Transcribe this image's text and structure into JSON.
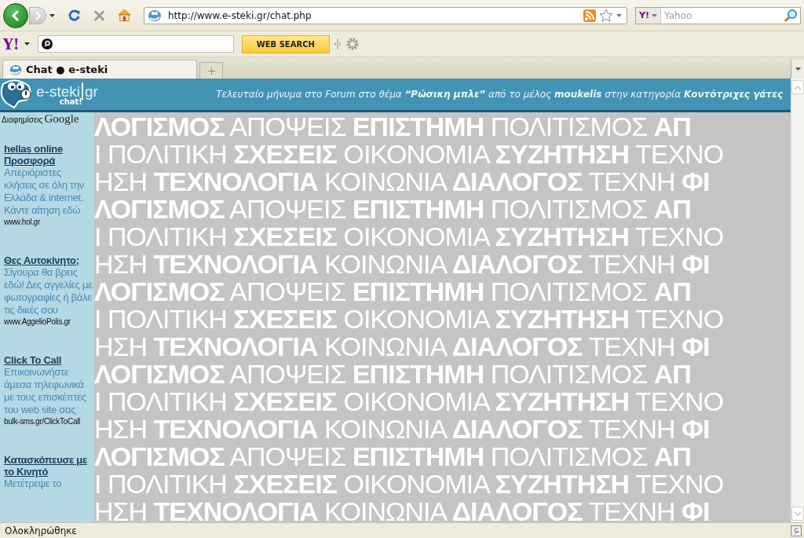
{
  "browser": {
    "address": "http://www.e-steki.gr/chat.php",
    "search_engine_logo": "Y!",
    "search": {
      "placeholder": "Yahoo"
    },
    "toolbar": {
      "logo": "Y!",
      "button": "WEB SEARCH"
    },
    "tabs": [
      {
        "label": "Chat ● e-steki",
        "selected": true
      }
    ]
  },
  "header": {
    "logo": {
      "name": "e-steki",
      "tld": "gr",
      "sub": "chat!"
    },
    "message": "Τελευταίο μήνυμα στο Forum στο θέμα **“Ρώσικη μπλε”** από το μέλος **moukelis** στην κατηγορία **Κοντότριχες γάτες**"
  },
  "sidebar": {
    "label": "Διαφημίσεις",
    "brand": "Google",
    "ads": [
      {
        "title": "hellas online Προσφορά",
        "body": "Απεριόριστες κλήσεις σε όλη την Ελλάδα & internet. Κάντε αίτηση εδώ",
        "url": "www.hol.gr"
      },
      {
        "title": "Θες Αυτοκίνητο;",
        "body": "Σίγουρα θα βρεις εδώ! Δες αγγελίες με φωτογραφίες ή βάλε τις δικές σου",
        "url": "www.AggelioPolis.gr"
      },
      {
        "title": "Click To Call",
        "body": "Επικοινωνήστε άμεσα τηλεφωνικά με τους επισκέπτες του web site σας",
        "url": "bulk-sms.gr/ClickToCall"
      },
      {
        "title": "Κατασκόπευσε με το Κινητό",
        "body": "Μετέτρεψε το"
      }
    ]
  },
  "background_pattern": [
    "**ΛΟΓΙΣΜΟΣ** ΑΠΟΨΕΙΣ **ΕΠΙΣΤΗΜΗ** ΠΟΛΙΤΙΣΜΟΣ **ΑΠ**",
    "Ι ΠΟΛΙΤΙΚΗ **ΣΧΕΣΕΙΣ** ΟΙΚΟΝΟΜΙΑ **ΣΥΖΗΤΗΣΗ** ΤΕΧΝΟ",
    "ΗΣΗ **ΤΕΧΝΟΛΟΓΙΑ** ΚΟΙΝΩΝΙΑ **ΔΙΑΛΟΓΟΣ** ΤΕΧΝΗ **ΦΙ**",
    "**ΛΟΓΙΣΜΟΣ** ΑΠΟΨΕΙΣ **ΕΠΙΣΤΗΜΗ** ΠΟΛΙΤΙΣΜΟΣ **ΑΠ**",
    "Ι ΠΟΛΙΤΙΚΗ **ΣΧΕΣΕΙΣ** ΟΙΚΟΝΟΜΙΑ **ΣΥΖΗΤΗΣΗ** ΤΕΧΝΟ",
    "ΗΣΗ **ΤΕΧΝΟΛΟΓΙΑ** ΚΟΙΝΩΝΙΑ **ΔΙΑΛΟΓΟΣ** ΤΕΧΝΗ **ΦΙ**",
    "**ΛΟΓΙΣΜΟΣ** ΑΠΟΨΕΙΣ **ΕΠΙΣΤΗΜΗ** ΠΟΛΙΤΙΣΜΟΣ **ΑΠ**",
    "Ι ΠΟΛΙΤΙΚΗ **ΣΧΕΣΕΙΣ** ΟΙΚΟΝΟΜΙΑ **ΣΥΖΗΤΗΣΗ** ΤΕΧΝΟ",
    "ΗΣΗ **ΤΕΧΝΟΛΟΓΙΑ** ΚΟΙΝΩΝΙΑ **ΔΙΑΛΟΓΟΣ** ΤΕΧΝΗ **ΦΙ**",
    "**ΛΟΓΙΣΜΟΣ** ΑΠΟΨΕΙΣ **ΕΠΙΣΤΗΜΗ** ΠΟΛΙΤΙΣΜΟΣ **ΑΠ**",
    "Ι ΠΟΛΙΤΙΚΗ **ΣΧΕΣΕΙΣ** ΟΙΚΟΝΟΜΙΑ **ΣΥΖΗΤΗΣΗ** ΤΕΧΝΟ",
    "ΗΣΗ **ΤΕΧΝΟΛΟΓΙΑ** ΚΟΙΝΩΝΙΑ **ΔΙΑΛΟΓΟΣ** ΤΕΧΝΗ **ΦΙ**",
    "**ΛΟΓΙΣΜΟΣ** ΑΠΟΨΕΙΣ **ΕΠΙΣΤΗΜΗ** ΠΟΛΙΤΙΣΜΟΣ **ΑΠ**",
    "Ι ΠΟΛΙΤΙΚΗ **ΣΧΕΣΕΙΣ** ΟΙΚΟΝΟΜΙΑ **ΣΥΖΗΤΗΣΗ** ΤΕΧΝΟ",
    "ΗΣΗ **ΤΕΧΝΟΛΟΓΙΑ** ΚΟΙΝΩΝΙΑ **ΔΙΑΛΟΓΟΣ** ΤΕΧΝΗ **ΦΙ**"
  ],
  "status_bar": {
    "text": "Ολοκληρώθηκε"
  }
}
